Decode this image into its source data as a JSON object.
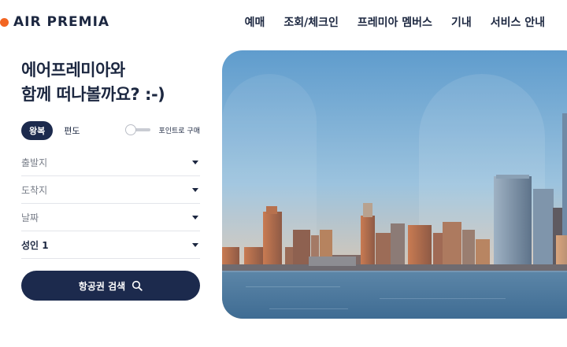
{
  "brand": {
    "name": "AIR PREMIA",
    "accent": "#f26522",
    "navy": "#1c2a4d"
  },
  "nav": {
    "items": [
      "예매",
      "조회/체크인",
      "프레미아 멤버스",
      "기내",
      "서비스 안내"
    ]
  },
  "booking": {
    "headline_line1": "에어프레미아와",
    "headline_line2": "함께 떠나볼까요? :-)",
    "trip_roundtrip": "왕복",
    "trip_oneway": "편도",
    "points_toggle_label": "포인트로 구매",
    "points_toggle_on": false,
    "fields": {
      "departure": "출발지",
      "arrival": "도착지",
      "date": "날짜",
      "passengers": "성인 1"
    },
    "search_label": "항공권 검색"
  },
  "hero": {
    "image_description_icon": "city-skyline-image"
  }
}
